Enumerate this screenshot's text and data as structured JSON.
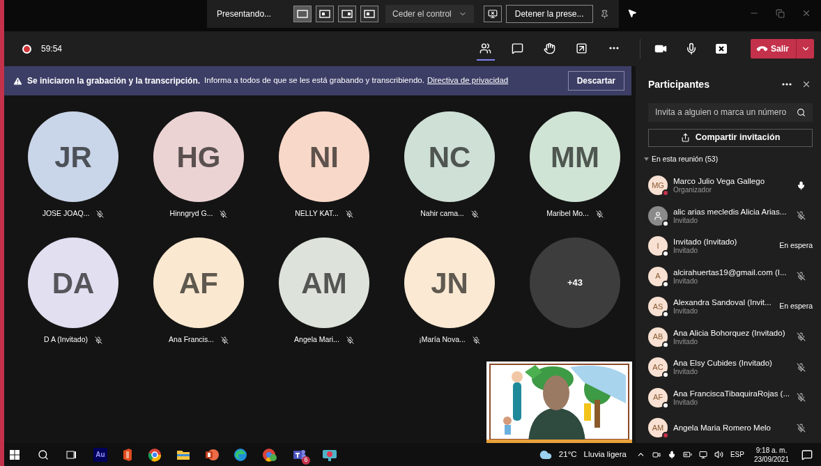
{
  "presenter_bar": {
    "status": "Presentando...",
    "layouts": [
      {
        "selected": true
      },
      {
        "selected": false
      },
      {
        "selected": false
      },
      {
        "selected": false
      }
    ],
    "control": "Ceder el control",
    "stop": "Detener la prese..."
  },
  "meeting_bar": {
    "recording": true,
    "timer": "59:54",
    "tools": [
      {
        "kind": "people",
        "selected": true
      },
      {
        "kind": "chat",
        "selected": false
      },
      {
        "kind": "reactions",
        "selected": false
      },
      {
        "kind": "rooms",
        "selected": false
      },
      {
        "kind": "more",
        "selected": false
      }
    ],
    "leave": "Salir"
  },
  "banner": {
    "title": "Se iniciaron la grabación y la transcripción.",
    "message": "Informa a todos de que se les está grabando y transcribiendo.",
    "link": "Directiva de privacidad",
    "dismiss": "Descartar"
  },
  "tiles": [
    {
      "kind": "avatar",
      "initials": "JR",
      "name": "JOSE JOAQ...",
      "color": "#c9d5e8"
    },
    {
      "kind": "avatar",
      "initials": "HG",
      "name": "Hinngryd G...",
      "color": "#ecd3d3"
    },
    {
      "kind": "avatar",
      "initials": "NI",
      "name": "NELLY KAT...",
      "color": "#f8d8c8"
    },
    {
      "kind": "avatar",
      "initials": "NC",
      "name": "Nahir cama...",
      "color": "#cfe0d6"
    },
    {
      "kind": "avatar",
      "initials": "MM",
      "name": "Maribel Mo...",
      "color": "#d0e4d5"
    },
    {
      "kind": "avatar",
      "initials": "DA",
      "name": "D A (Invitado)",
      "color": "#e1dff0"
    },
    {
      "kind": "avatar",
      "initials": "AF",
      "name": "Ana Francis...",
      "color": "#fbe8d0"
    },
    {
      "kind": "avatar",
      "initials": "AM",
      "name": "Angela Mari...",
      "color": "#dde3da"
    },
    {
      "kind": "avatar",
      "initials": "JN",
      "name": "¡María Nova...",
      "color": "#fbe9d3"
    },
    {
      "kind": "overflow",
      "initials": "+43",
      "color": "#3d3d3d"
    }
  ],
  "panel": {
    "title": "Participantes",
    "search": {
      "placeholder": "Invita a alguien o marca un número"
    },
    "share": "Compartir invitación",
    "section": {
      "label": "En esta reunión (53)",
      "expanded": true
    },
    "people": [
      {
        "kind": "initials",
        "initials": "MG",
        "name": "Marco Julio Vega Gallego",
        "role": "Organizador",
        "color": "#c4314b",
        "indicator": {
          "kind": "mic"
        }
      },
      {
        "kind": "silhouette",
        "name": "alic arias mecledis Alicia Arias...",
        "role": "Invitado",
        "color": "#ffffff",
        "indicator": {
          "kind": "muted"
        }
      },
      {
        "kind": "initials",
        "initials": "I",
        "name": "Invitado (Invitado)",
        "role": "Invitado",
        "color": "#ffffff",
        "indicator": {
          "kind": "waiting",
          "text": "En espera"
        }
      },
      {
        "kind": "initials",
        "initials": "A",
        "name": "alcirahuertas19@gmail.com (I...",
        "role": "Invitado",
        "color": "#ffffff",
        "indicator": {
          "kind": "muted"
        }
      },
      {
        "kind": "initials",
        "initials": "AS",
        "name": "Alexandra Sandoval (Invit...",
        "role": "Invitado",
        "color": "#ffffff",
        "indicator": {
          "kind": "waiting",
          "text": "En espera"
        }
      },
      {
        "kind": "initials",
        "initials": "AB",
        "name": "Ana Alicia Bohorquez (Invitado)",
        "role": "Invitado",
        "color": "#ffffff",
        "indicator": {
          "kind": "muted"
        }
      },
      {
        "kind": "initials",
        "initials": "AC",
        "name": "Ana Elsy Cubides (Invitado)",
        "role": "Invitado",
        "color": "#ffffff",
        "indicator": {
          "kind": "muted"
        }
      },
      {
        "kind": "initials",
        "initials": "AF",
        "name": "Ana FranciscaTibaquiraRojas (...",
        "role": "Invitado",
        "color": "#ffffff",
        "indicator": {
          "kind": "muted"
        }
      },
      {
        "kind": "initials",
        "initials": "AM",
        "name": "Angela Maria Romero Melo",
        "color": "#c4314b",
        "indicator": {
          "kind": "muted"
        }
      }
    ]
  },
  "taskbar": {
    "apps": [
      {
        "kind": "audition",
        "label": "Au"
      },
      {
        "kind": "office"
      },
      {
        "kind": "chrome"
      },
      {
        "kind": "folder"
      },
      {
        "kind": "powerpoint"
      },
      {
        "kind": "edge"
      },
      {
        "kind": "chrome-profile"
      },
      {
        "kind": "teams",
        "badge": "6"
      },
      {
        "kind": "camera"
      }
    ],
    "temperature": "21°C",
    "weather": "Lluvia ligera",
    "language": "ESP",
    "time": "9:18 a. m.",
    "date": "23/09/2021"
  }
}
